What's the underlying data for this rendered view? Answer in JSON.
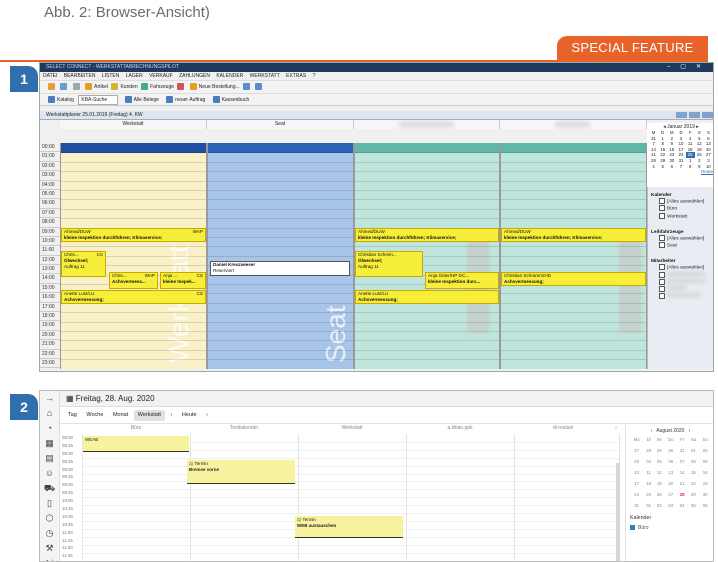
{
  "caption": "Abb. 2: Browser-Ansicht)",
  "badge": "SPECIAL FEATURE",
  "marker1": "1",
  "marker2": "2",
  "colors": {
    "accent": "#e8632a",
    "marker": "#2f6fad",
    "event": "#f7ee3a"
  },
  "app1": {
    "title": "SELECT CONNECT - WERKSTATTABRECHNUNGSPILOT",
    "menu": [
      "DATEI",
      "BEARBEITEN",
      "LISTEN",
      "LAGER",
      "VERKAUF",
      "ZAHLUNGEN",
      "KALENDER",
      "WERKSTATT",
      "EXTRAS",
      "?"
    ],
    "toolbar1": [
      "Artikel",
      "Kunden",
      "Fahrzeuge",
      "Neue Bestellung..."
    ],
    "toolbar2": {
      "katalog": "Katalog",
      "search": "KBA-Suche",
      "alle_belege": "Alle Belege",
      "neuer_auftrag": "neuer Auftrag",
      "kassenbuch": "Kassenbuch"
    },
    "window_title": "Werkstattplaner 25.01.2019 (Freitag) 4. KW",
    "columns": [
      "Werkstatt",
      "Seat"
    ],
    "times": [
      "00:00",
      "01:00",
      "02:00",
      "03:00",
      "04:00",
      "05:00",
      "06:00",
      "07:00",
      "08:00",
      "09:00",
      "10:00",
      "11:00",
      "12:00",
      "13:00",
      "14:00",
      "15:00",
      "16:00",
      "17:00",
      "18:00",
      "19:00",
      "20:00",
      "21:00",
      "22:00",
      "23:00"
    ],
    "watermarks": [
      "Werkstatt",
      "Seat"
    ],
    "events": {
      "e1_title": "Ahmed/DUW",
      "e1_tag": "WAP",
      "e1_text": "kleine Inspektion durchführen; Klimaservice;",
      "e2_title": "Chris...",
      "e2_tag": "CS",
      "e2_text": "Ölwechsel;",
      "e2_sub": "Auftrag 11",
      "e3_title": "Chris...",
      "e3_tag": "WAP",
      "e3_text": "Achsvermess...",
      "e4_title": "Anja ...",
      "e4_tag": "CS",
      "e4_text": "kleine Inspek...",
      "e5_title": "Anette Lutz/LU",
      "e5_tag": "CS",
      "e5_text": "Achsvermessung;",
      "e6_title": "Daniel Kreuzwieser",
      "e6_sub": "Reserviert",
      "e7_title": "Ahmed/DUW",
      "e7_text": "kleine Inspektion durchführen; Klimaservice;",
      "e8_title": "Christian Schrein...",
      "e8_text": "Ölwechsel;",
      "e8_sub": "Auftrag 11",
      "e9_title": "Anja Güler/HP DC...",
      "e9_text": "kleine Inspektion durc...",
      "e10_title": "Anette Lutz/LU",
      "e10_text": "Achsvermessung;",
      "e11_title": "Christian Schramm/HD",
      "e11_text": "Achsvermessung;"
    },
    "mini_cal": {
      "month": "Januar 2019",
      "dow": [
        "M",
        "D",
        "M",
        "D",
        "F",
        "S",
        "S"
      ],
      "rows": [
        [
          "31",
          "1",
          "2",
          "3",
          "4",
          "5",
          "6"
        ],
        [
          "7",
          "8",
          "9",
          "10",
          "11",
          "12",
          "13"
        ],
        [
          "14",
          "15",
          "16",
          "17",
          "18",
          "19",
          "20"
        ],
        [
          "21",
          "22",
          "23",
          "24",
          "25",
          "26",
          "27"
        ],
        [
          "28",
          "29",
          "30",
          "31",
          "1",
          "2",
          "3"
        ],
        [
          "4",
          "5",
          "6",
          "7",
          "8",
          "9",
          "10"
        ]
      ],
      "today": "25",
      "heute": "Heute"
    },
    "side": {
      "kalender": "Kalender",
      "alles": "[Alles auswählen]",
      "buero": "Büro",
      "werkstatt": "Werkstatt",
      "leih": "Leihfahrzeuge",
      "seat": "Seat",
      "mitarbeiter": "Mitarbeiter"
    }
  },
  "app2": {
    "date": "Freitag, 28. Aug. 2020",
    "tabs": [
      "Tag",
      "Woche",
      "Monat",
      "Werkstatt"
    ],
    "today_btn": "Heute",
    "columns": [
      "Büro",
      "Testkalender",
      "Werkstatt",
      "a.kilian.ppk",
      "dl-restsel"
    ],
    "times": [
      "08:00",
      "08:15",
      "08:30",
      "08:45",
      "09:00",
      "09:15",
      "09:30",
      "09:45",
      "10:00",
      "10:15",
      "10:30",
      "10:45",
      "11:00",
      "11:15",
      "11:30",
      "11:45"
    ],
    "ev1": "WEAB",
    "ev2_title": "Termin",
    "ev2_text": "Bremse vorne",
    "ev3_title": "Termin",
    "ev3_text": "WEB austauschen",
    "cal": {
      "month": "August 2020",
      "dow": [
        "Mo",
        "Di",
        "Mi",
        "Do",
        "Fr",
        "Sa",
        "So"
      ],
      "rows": [
        [
          "27",
          "28",
          "29",
          "30",
          "31",
          "01",
          "02"
        ],
        [
          "03",
          "04",
          "05",
          "06",
          "07",
          "08",
          "09"
        ],
        [
          "10",
          "11",
          "12",
          "13",
          "14",
          "15",
          "16"
        ],
        [
          "17",
          "18",
          "19",
          "20",
          "21",
          "22",
          "23"
        ],
        [
          "24",
          "25",
          "26",
          "27",
          "28",
          "29",
          "30"
        ],
        [
          "31",
          "01",
          "02",
          "03",
          "04",
          "05",
          "06"
        ]
      ],
      "today": "28",
      "kalender": "Kalender",
      "buero": "Büro"
    }
  }
}
